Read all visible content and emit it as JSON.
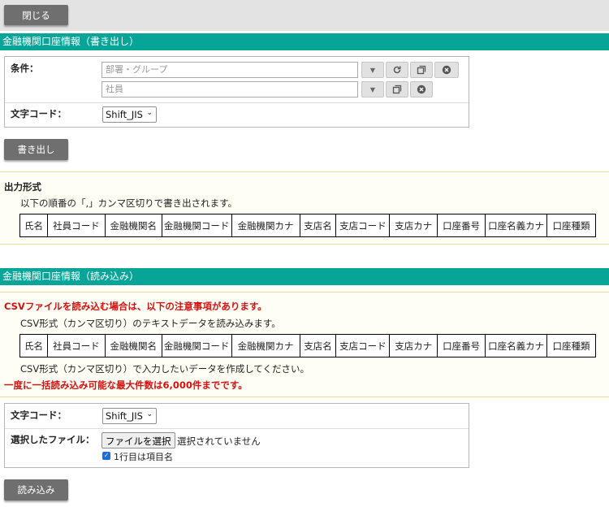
{
  "toolbar": {
    "close_label": "閉じる"
  },
  "export_section": {
    "title": "金融機関口座情報（書き出し）",
    "condition_label": "条件：",
    "dept_placeholder": "部署・グループ",
    "employee_placeholder": "社員",
    "charset_label": "文字コード：",
    "charset_value": "Shift_JIS",
    "export_button": "書き出し"
  },
  "output_format": {
    "title": "出力形式",
    "description": "以下の順番の「,」カンマ区切りで書き出されます。",
    "columns": [
      "氏名",
      "社員コード",
      "金融機関名",
      "金融機関コード",
      "金融機関カナ",
      "支店名",
      "支店コード",
      "支店カナ",
      "口座番号",
      "口座名義カナ",
      "口座種類"
    ]
  },
  "import_section": {
    "title": "金融機関口座情報（読み込み）",
    "notice_title": "CSVファイルを読み込む場合は、以下の注意事項があります。",
    "line1": "CSV形式（カンマ区切り）のテキストデータを読み込みます。",
    "columns": [
      "氏名",
      "社員コード",
      "金融機関名",
      "金融機関コード",
      "金融機関カナ",
      "支店名",
      "支店コード",
      "支店カナ",
      "口座番号",
      "口座名義カナ",
      "口座種類"
    ],
    "line2": "CSV形式（カンマ区切り）で入力したいデータを作成してください。",
    "limit_note": "一度に一括読み込み可能な最大件数は6,000件までです。",
    "charset_label": "文字コード：",
    "charset_value": "Shift_JIS",
    "file_label": "選択したファイル：",
    "file_button": "ファイルを選択",
    "file_status": "選択されていません",
    "header_checkbox_label": "1行目は項目名",
    "import_button": "読み込み"
  }
}
